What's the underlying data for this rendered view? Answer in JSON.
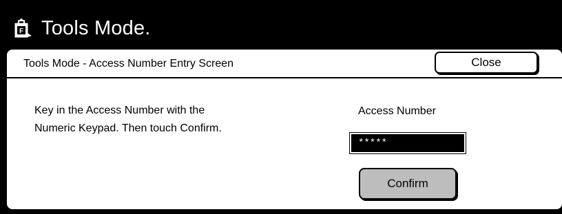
{
  "window": {
    "title": "Tools Mode.",
    "icon": "tools-mode-icon"
  },
  "dialog": {
    "title": "Tools Mode - Access Number Entry Screen",
    "close_label": "Close"
  },
  "instructions": {
    "line1": "Key in the Access Number with the",
    "line2": "Numeric Keypad.  Then touch Confirm."
  },
  "access": {
    "label": "Access Number",
    "value": "*****"
  },
  "confirm_label": "Confirm",
  "colors": {
    "background": "#000000",
    "panel": "#ffffff",
    "button": "#bdbdbd",
    "field": "#000000"
  }
}
